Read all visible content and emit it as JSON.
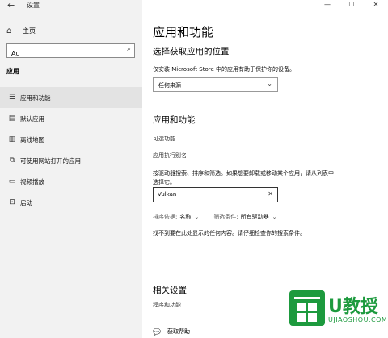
{
  "window": {
    "title": "设置",
    "controls": [
      "—",
      "☐",
      "✕"
    ]
  },
  "sidebar": {
    "home_label": "主页",
    "search_value": "Au",
    "section": "应用",
    "items": [
      {
        "label": "应用和功能",
        "icon": "apps-list-icon"
      },
      {
        "label": "默认应用",
        "icon": "default-apps-icon"
      },
      {
        "label": "离线地图",
        "icon": "offline-maps-icon"
      },
      {
        "label": "可使用网站打开的应用",
        "icon": "website-apps-icon"
      },
      {
        "label": "视频播放",
        "icon": "video-playback-icon"
      },
      {
        "label": "启动",
        "icon": "startup-icon"
      }
    ]
  },
  "main": {
    "title": "应用和功能",
    "install_heading": "选择获取应用的位置",
    "install_desc": "仅安装 Microsoft Store 中的应用有助于保护你的设备。",
    "source_selected": "任何来源",
    "apps_heading": "应用和功能",
    "optional_features": "可选功能",
    "app_aliases": "应用执行别名",
    "filter_desc_1": "按驱动器搜索、排序和筛选。如果想要卸载或移动某个应用，请从列表中",
    "filter_desc_2": "选择它。",
    "filter_value": "Vulkan",
    "sort_key": "排序依据:",
    "sort_value": "名称",
    "filter_key": "筛选条件:",
    "filter_drive": "所有驱动器",
    "no_results": "找不到要在此处显示的任何内容。请仔细检查你的搜索条件。",
    "related_heading": "相关设置",
    "related_link": "程序和功能",
    "help_label": "获取帮助"
  },
  "watermark": {
    "text": "U教授",
    "sub": "UJIAOSHOU.COM",
    "color": "#1d9a3e"
  }
}
